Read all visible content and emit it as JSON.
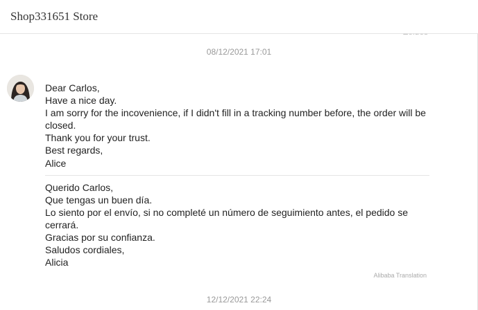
{
  "header": {
    "store_name": "Shop331651 Store"
  },
  "chat": {
    "clipped_previous_text": "Zeldes",
    "messages": [
      {
        "timestamp": "08/12/2021 17:01",
        "original_lines": [
          "Dear Carlos,",
          "Have a nice day.",
          "I am sorry for the incovenience, if I didn't fill in a tracking number before, the order will be closed.",
          "Thank you for your trust.",
          "Best regards,",
          "Alice"
        ],
        "translated_lines": [
          "Querido Carlos,",
          "Que tengas un buen día.",
          "Lo siento por el envío, si no completé un número de seguimiento antes, el pedido se cerrará.",
          "Gracias por su confianza.",
          "Saludos cordiales,",
          "Alicia"
        ],
        "translation_credit": "Alibaba Translation"
      }
    ],
    "next_timestamp": "12/12/2021 22:24"
  }
}
